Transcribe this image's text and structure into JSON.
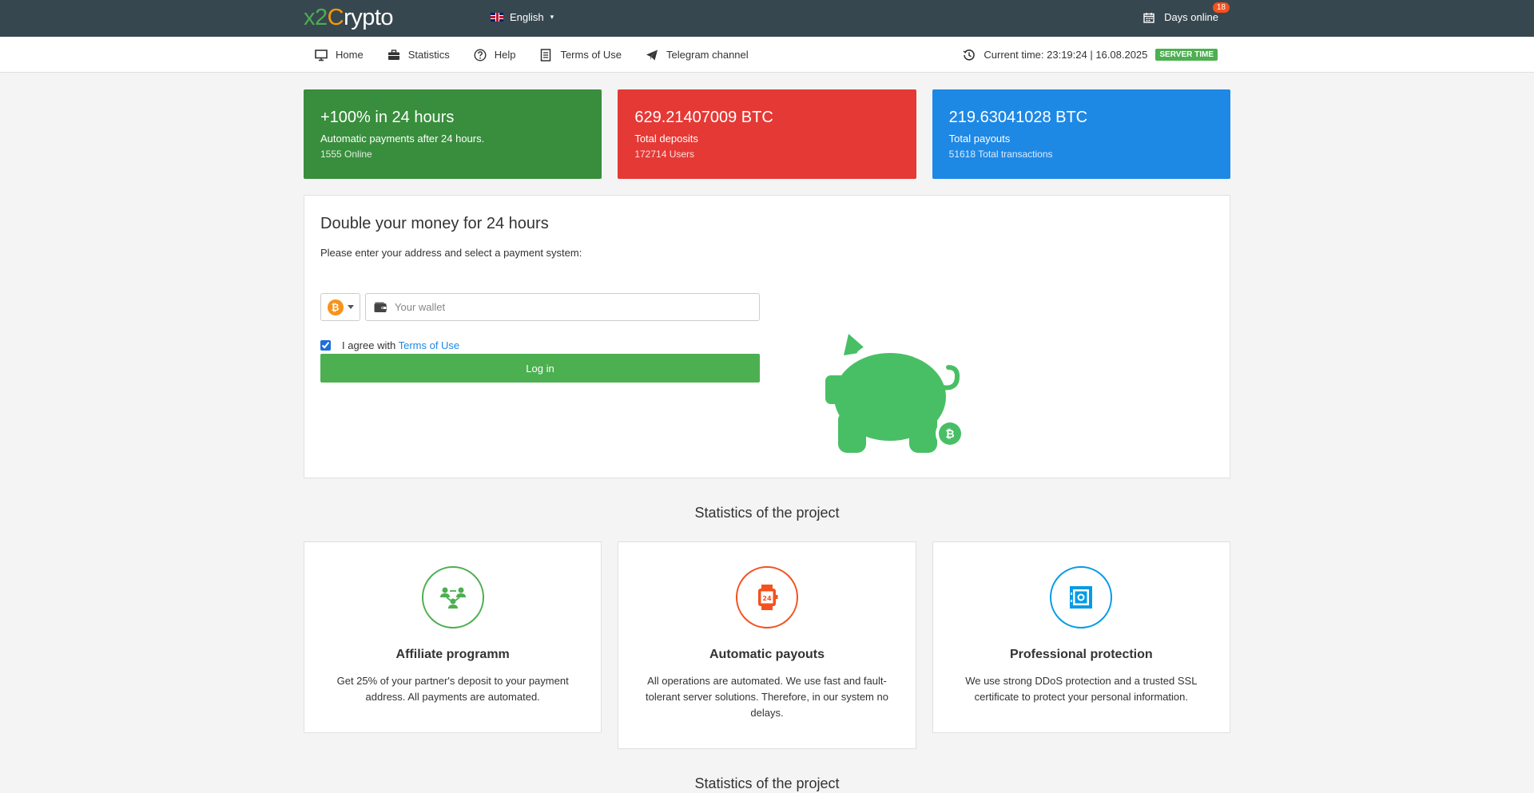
{
  "header": {
    "logo_part1": "x2",
    "logo_part2": "C",
    "logo_part3": "rypto",
    "language": "English",
    "days_online_label": "Days online",
    "days_online_count": "18"
  },
  "nav": {
    "items": [
      {
        "label": "Home",
        "icon": "monitor-icon"
      },
      {
        "label": "Statistics",
        "icon": "briefcase-icon"
      },
      {
        "label": "Help",
        "icon": "question-circle-icon"
      },
      {
        "label": "Terms of Use",
        "icon": "document-icon"
      },
      {
        "label": "Telegram channel",
        "icon": "paper-plane-icon"
      }
    ],
    "current_time": "Current time: 23:19:24 | 16.08.2025",
    "server_badge": "SERVER TIME"
  },
  "cards": [
    {
      "big": "+100% in 24 hours",
      "mid": "Automatic payments after 24 hours.",
      "small": "1555 Online",
      "color": "#388e3c"
    },
    {
      "big": "629.21407009 BTC",
      "mid": "Total deposits",
      "small": "172714 Users",
      "color": "#e53935"
    },
    {
      "big": "219.63041028 BTC",
      "mid": "Total payouts",
      "small": "51618 Total transactions",
      "color": "#1e88e5"
    }
  ],
  "main": {
    "title": "Double your money for 24 hours",
    "subtitle": "Please enter your address and select a payment system:",
    "coin_symbol": "₿",
    "wallet_placeholder": "Your wallet",
    "agree_text": "I agree with",
    "agree_link": "Terms of Use",
    "agree_checked": true,
    "login_label": "Log in"
  },
  "stats": {
    "title": "Statistics of the project",
    "title2": "Statistics of the project",
    "features": [
      {
        "title": "Affiliate programm",
        "text": "Get 25% of your partner's deposit to your payment address. All payments are automated.",
        "icon": "affiliate-network-icon",
        "color": "#4caf50"
      },
      {
        "title": "Automatic payouts",
        "text": "All operations are automated. We use fast and fault-tolerant server solutions. Therefore, in our system no delays.",
        "icon": "24h-watch-icon",
        "color": "#f4511e"
      },
      {
        "title": "Professional protection",
        "text": "We use strong DDoS protection and a trusted SSL certificate to protect your personal information.",
        "icon": "safe-icon",
        "color": "#039be5"
      }
    ]
  }
}
